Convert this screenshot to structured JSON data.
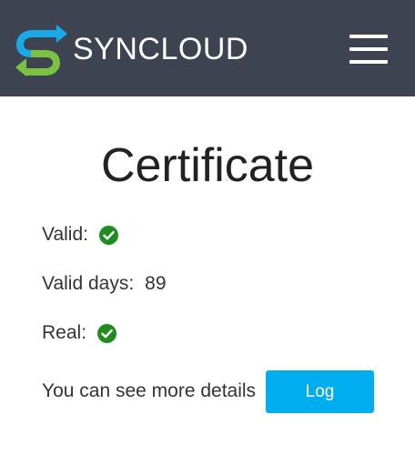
{
  "header": {
    "brand": "SYNCLOUD",
    "logo_icon": "syncloud-logo-icon",
    "menu_icon": "hamburger-menu-icon",
    "background_color": "#3d4350"
  },
  "page": {
    "title": "Certificate"
  },
  "certificate": {
    "valid_label": "Valid:",
    "valid_icon": "check-circle-icon",
    "valid_days_label": "Valid days:",
    "valid_days_value": "89",
    "real_label": "Real:",
    "real_icon": "check-circle-icon",
    "details_text": "You can see more details",
    "log_button_label": "Log",
    "check_color": "#1e8c1e",
    "button_color": "#00aeef"
  }
}
